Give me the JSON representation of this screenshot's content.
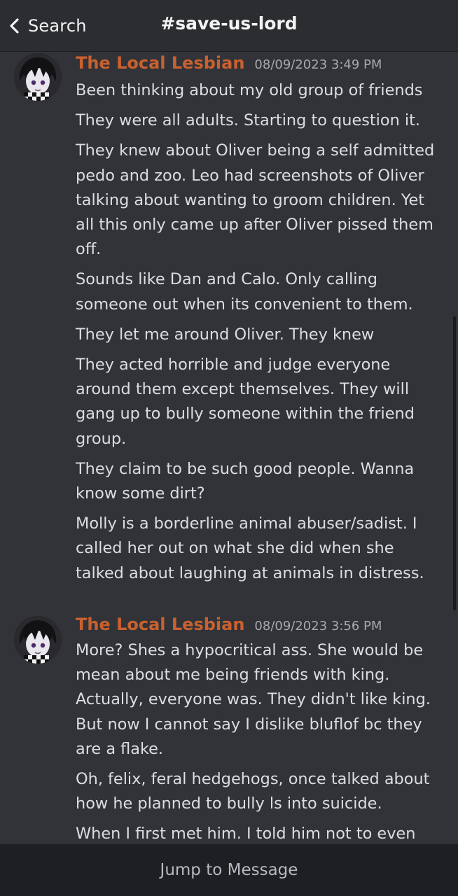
{
  "topbar": {
    "back_label": "Search",
    "channel": "#save-us-lord"
  },
  "messages": [
    {
      "author": "The Local Lesbian",
      "timestamp": "08/09/2023 3:49 PM",
      "lines": [
        "Been thinking about my old group of friends",
        "They were all adults. Starting to question it.",
        "They knew about Oliver being a self admitted pedo and zoo. Leo had screenshots of Oliver talking about wanting to groom children. Yet all this only came up after Oliver pissed them off.",
        "Sounds like Dan and Calo. Only calling someone out when its convenient to them.",
        "They let me around Oliver. They knew",
        "They acted horrible and judge everyone around them except themselves. They will gang up to bully someone within the friend group.",
        "They claim to be such good people. Wanna know some dirt?",
        "Molly is a borderline animal abuser/sadist. I called her out on what she did when she talked about laughing at animals in distress."
      ]
    },
    {
      "author": "The Local Lesbian",
      "timestamp": "08/09/2023 3:56 PM",
      "lines": [
        "More? Shes a hypocritical ass. She would be mean about me being friends with king. Actually, everyone was. They didn't like king. But now I cannot say I dislike bluflof bc they are a flake.",
        "Oh, felix, feral hedgehogs, once talked about how he planned to bully ls into suicide.",
        "When I first met him. I told him not to even"
      ]
    }
  ],
  "bottombar": {
    "jump_label": "Jump to Message"
  },
  "colors": {
    "background": "#313338",
    "author": "#c9612f",
    "text": "#dbdee1",
    "timestamp": "#a6a9ae",
    "bottombar": "#1e1f22"
  }
}
